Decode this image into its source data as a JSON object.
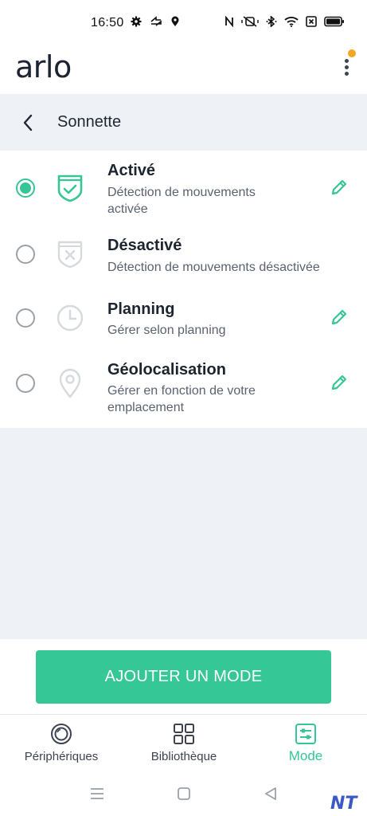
{
  "status_bar": {
    "time": "16:50",
    "left_icons": [
      "gear-icon",
      "share-icon",
      "location-icon"
    ],
    "right_icons": [
      "nfc-icon",
      "mute-icon",
      "bluetooth-icon",
      "wifi-icon",
      "sim-icon",
      "battery-icon"
    ]
  },
  "header": {
    "logo": "arlo",
    "menu_icon": "kebab-menu-icon",
    "notification_color": "#f5a623"
  },
  "sub_header": {
    "title": "Sonnette"
  },
  "modes": [
    {
      "title": "Activé",
      "description": "Détection de mouvements activée",
      "selected": true,
      "icon": "shield-check-icon",
      "editable": true
    },
    {
      "title": "Désactivé",
      "description": "Détection de mouvements désactivée",
      "selected": false,
      "icon": "shield-x-icon",
      "editable": false
    },
    {
      "title": "Planning",
      "description": "Gérer selon planning",
      "selected": false,
      "icon": "clock-icon",
      "editable": true
    },
    {
      "title": "Géolocalisation",
      "description": "Gérer en fonction de votre emplacement",
      "selected": false,
      "icon": "location-pin-icon",
      "editable": true
    }
  ],
  "add_button": {
    "label": "AJOUTER UN MODE"
  },
  "bottom_nav": {
    "items": [
      {
        "label": "Périphériques",
        "icon": "devices-icon",
        "active": false
      },
      {
        "label": "Bibliothèque",
        "icon": "library-grid-icon",
        "active": false
      },
      {
        "label": "Mode",
        "icon": "mode-sliders-icon",
        "active": true
      }
    ]
  },
  "watermark": "NT",
  "colors": {
    "accent": "#35c596",
    "background_gray": "#eef1f5",
    "inactive_icon": "#d6dade"
  }
}
